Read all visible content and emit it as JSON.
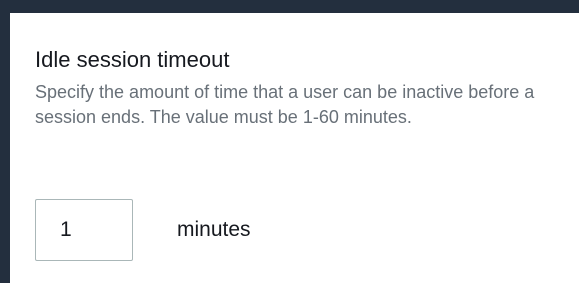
{
  "idle_timeout": {
    "title": "Idle session timeout",
    "description": "Specify the amount of time that a user can be inactive before a session ends. The value must be 1-60 minutes.",
    "value": "1",
    "unit": "minutes"
  }
}
